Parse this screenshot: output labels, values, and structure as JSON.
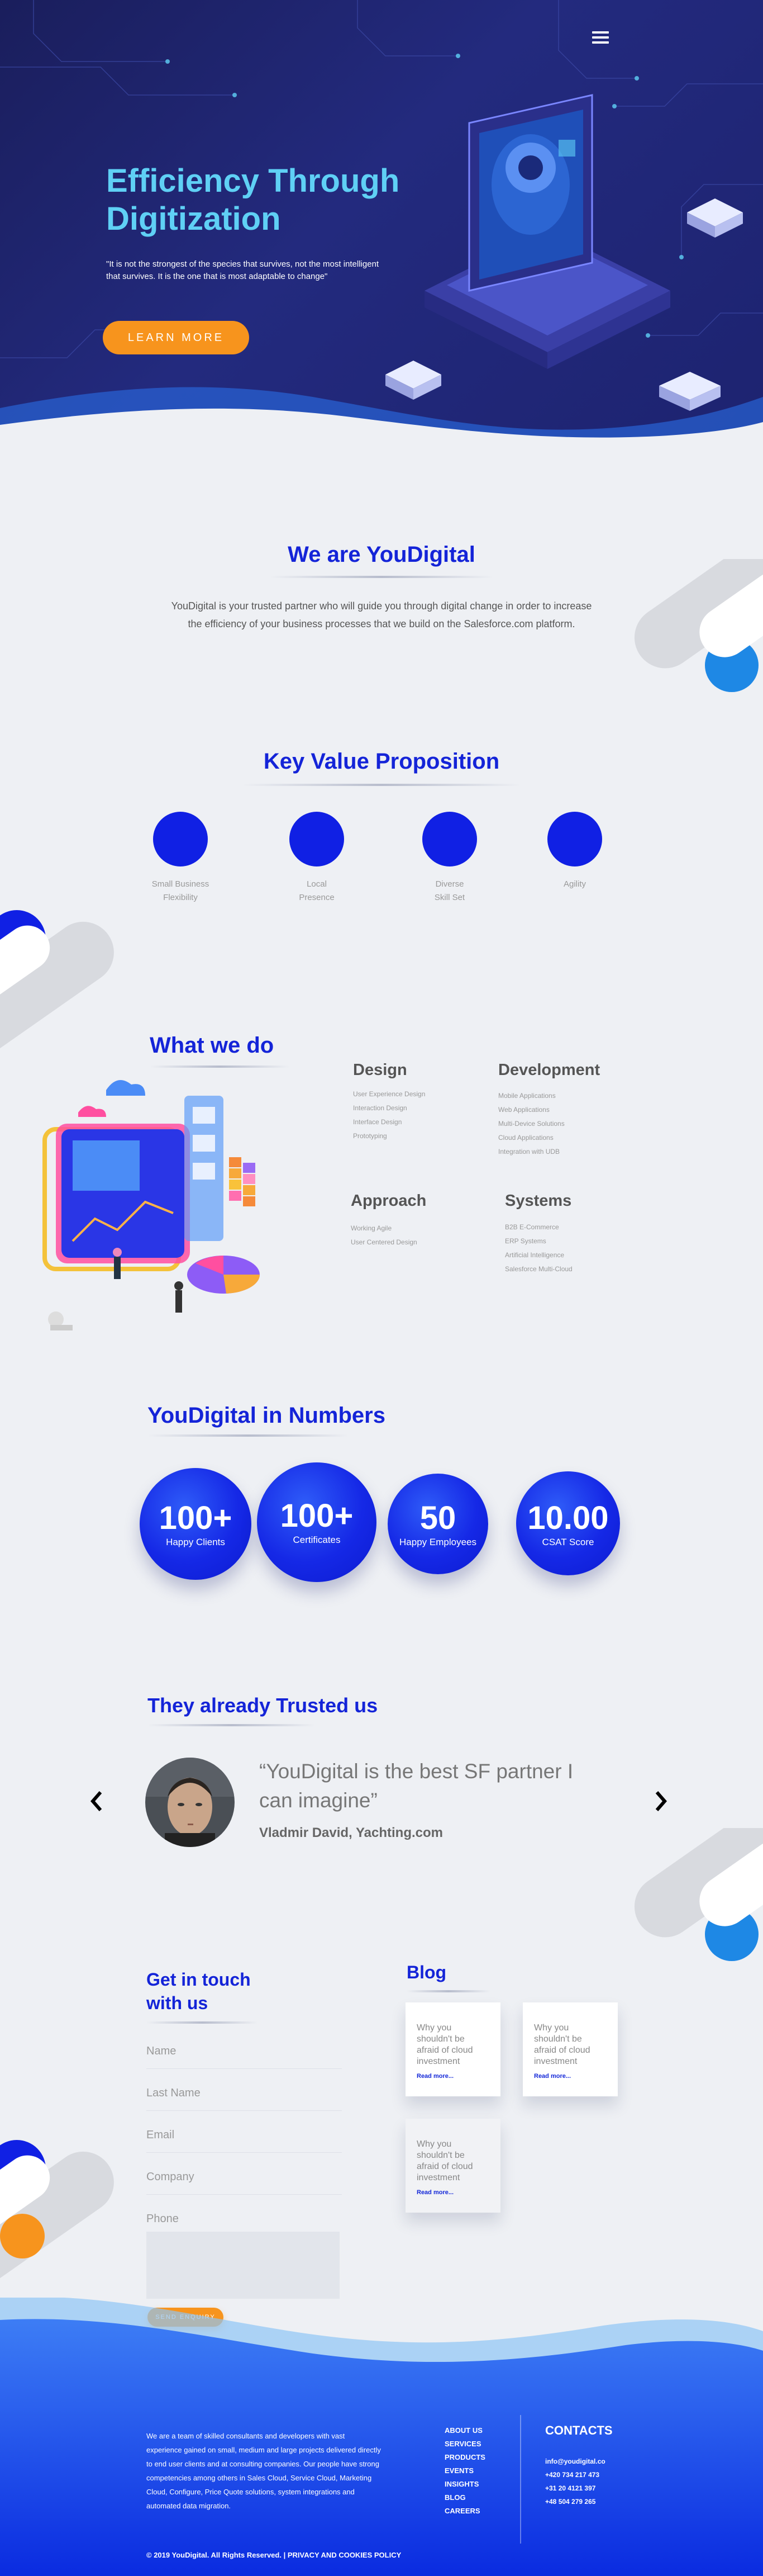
{
  "hero": {
    "title_line1": "Efficiency Through",
    "title_line2": "Digitization",
    "quote": "\"It is not the strongest of the species that survives, not the most intelligent that survives. It is the one that is most adaptable to change\"",
    "cta": "LEARN MORE"
  },
  "about": {
    "title": "We are YouDigital",
    "text": "YouDigital is your trusted partner who will guide you through digital change in order to increase the efficiency of your business processes that we build on the Salesforce.com platform."
  },
  "kvp": {
    "title": "Key Value Proposition",
    "items": [
      {
        "line1": "Small Business",
        "line2": "Flexibility"
      },
      {
        "line1": "Local",
        "line2": "Presence"
      },
      {
        "line1": "Diverse",
        "line2": "Skill Set"
      },
      {
        "line1": "Agility",
        "line2": ""
      }
    ]
  },
  "what_we_do": {
    "title": "What we do",
    "groups": [
      {
        "title": "Design",
        "items": [
          "User Experience Design",
          "Interaction Design",
          "Interface Design",
          "Prototyping"
        ]
      },
      {
        "title": "Development",
        "items": [
          "Mobile Applications",
          "Web Applications",
          "Multi-Device Solutions",
          "Cloud Applications",
          "Integration with UDB"
        ]
      },
      {
        "title": "Approach",
        "items": [
          "Working Agile",
          "User Centered Design"
        ]
      },
      {
        "title": "Systems",
        "items": [
          "B2B E-Commerce",
          "ERP Systems",
          "Artificial Intelligence",
          "Salesforce Multi-Cloud"
        ]
      }
    ]
  },
  "numbers": {
    "title": "YouDigital in Numbers",
    "items": [
      {
        "value": "100+",
        "label": "Happy Clients"
      },
      {
        "value": "100+",
        "label": "Certificates"
      },
      {
        "value": "50",
        "label": "Happy Employees"
      },
      {
        "value": "10.00",
        "label": "CSAT Score"
      }
    ]
  },
  "testimonials": {
    "title": "They already Trusted us",
    "quote": "“YouDigital is the best SF partner I can imagine”",
    "author": "Vladmir David, Yachting.com"
  },
  "contact": {
    "title_line1": "Get in touch",
    "title_line2": "with us",
    "fields": [
      "Name",
      "Last Name",
      "Email",
      "Company",
      "Phone"
    ],
    "send": "SEND ENQUIRY"
  },
  "blog": {
    "title": "Blog",
    "cards": [
      {
        "title": "Why you shouldn't be afraid of cloud investment",
        "link": "Read more..."
      },
      {
        "title": "Why you shouldn't be afraid of cloud investment",
        "link": "Read more..."
      },
      {
        "title": "Why you shouldn't be afraid of cloud investment",
        "link": "Read more..."
      }
    ]
  },
  "footer": {
    "about": "We are a team of skilled consultants and developers with vast experience gained on small, medium and large projects delivered directly to end user clients and at consulting companies. Our people have strong competencies among others in Sales Cloud, Service Cloud, Marketing Cloud, Configure, Price Quote solutions, system integrations and automated data migration.",
    "nav": [
      "ABOUT US",
      "SERVICES",
      "PRODUCTS",
      "EVENTS",
      "INSIGHTS",
      "BLOG",
      "CAREERS"
    ],
    "contacts_title": "CONTACTS",
    "contacts": [
      "info@youdigital.co",
      "+420 734 217 473",
      "+31 20 4121 397",
      "+48 504 279 265"
    ],
    "copyright": "© 2019 YouDigital. All Rights Reserved. | PRIVACY AND COOKIES POLICY"
  },
  "colors": {
    "brand_blue": "#1424d8",
    "accent_orange": "#f7941d",
    "hero_title": "#5fd0f5",
    "hero_bg": "#1d2370"
  },
  "icons": [
    "menu-icon",
    "chevron-left-icon",
    "chevron-right-icon"
  ]
}
